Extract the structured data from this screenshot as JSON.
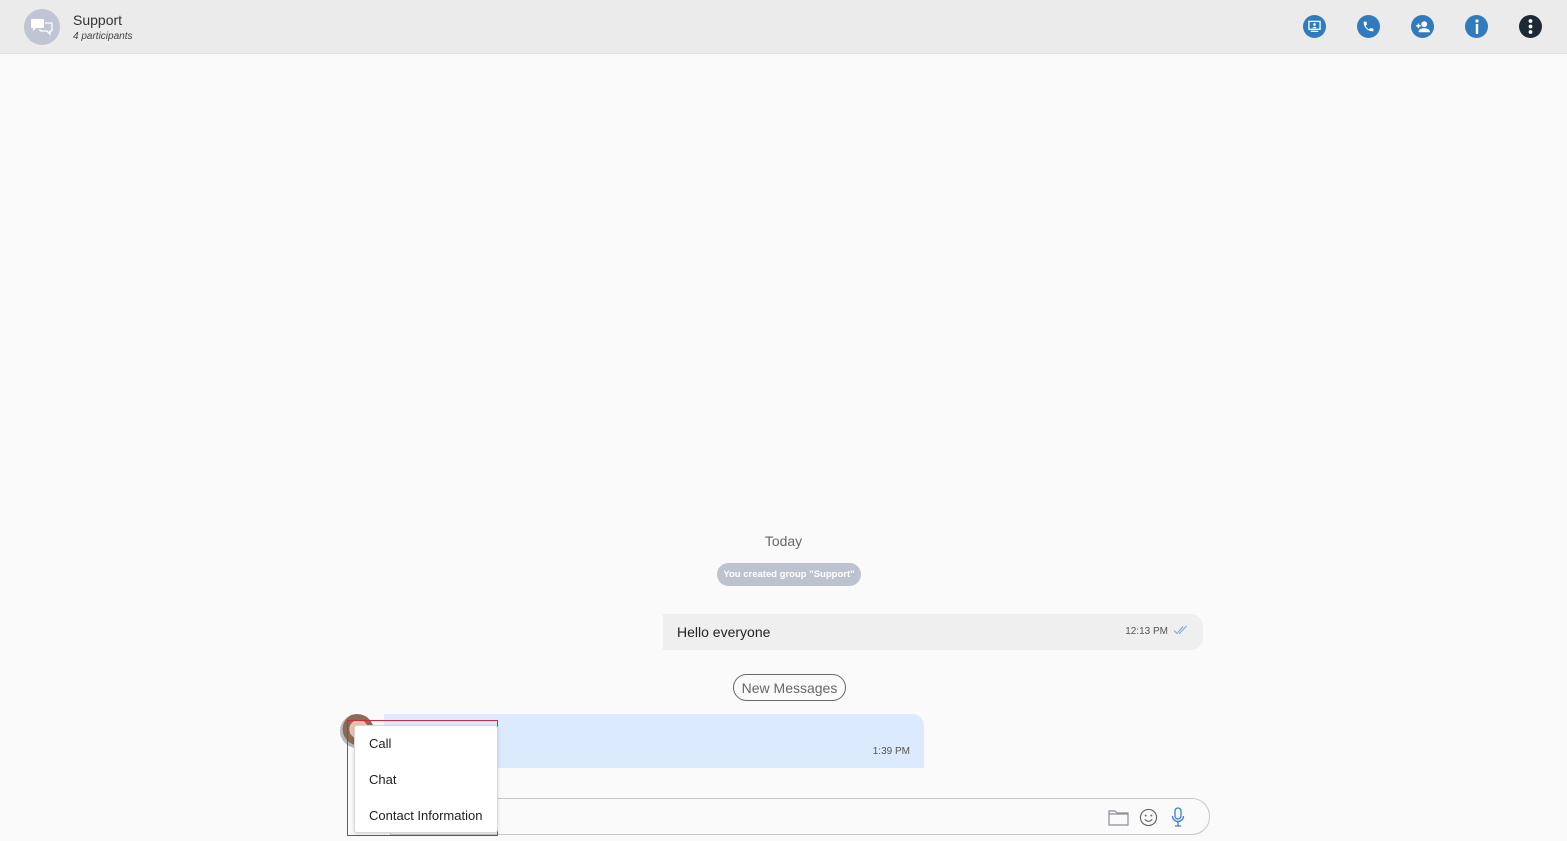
{
  "header": {
    "title": "Support",
    "subtitle": "4 participants",
    "actions": [
      {
        "name": "screen-share",
        "icon": "screen-share-icon"
      },
      {
        "name": "call",
        "icon": "phone-icon"
      },
      {
        "name": "add-participant",
        "icon": "add-user-icon"
      },
      {
        "name": "info",
        "icon": "info-icon"
      },
      {
        "name": "more",
        "icon": "more-vertical-icon"
      }
    ]
  },
  "conversation": {
    "date_divider": "Today",
    "system_message": "You created group \"Support\"",
    "outgoing": {
      "text": "Hello everyone",
      "time": "12:13 PM",
      "status": "read"
    },
    "new_messages_label": "New Messages",
    "incoming": {
      "sender": "",
      "text": "",
      "time": "1:39 PM"
    }
  },
  "context_menu": {
    "items": [
      "Call",
      "Chat",
      "Contact Information"
    ]
  },
  "composer": {
    "placeholder": "",
    "icons": [
      "folder-icon",
      "emoji-icon",
      "microphone-icon"
    ]
  },
  "colors": {
    "accent": "#2f7bbd",
    "highlight": "#d6283a",
    "incoming_bubble": "#dbeafc",
    "outgoing_bubble": "#efefef"
  }
}
